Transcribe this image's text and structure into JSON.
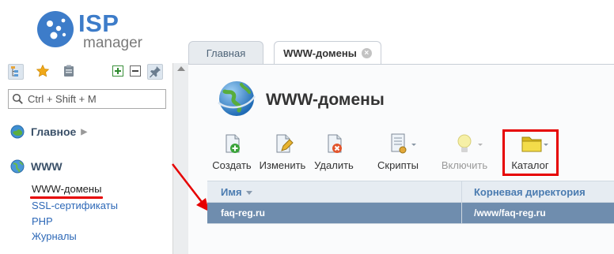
{
  "logo": {
    "brand": "ISP",
    "product": "manager"
  },
  "sidebar": {
    "search_placeholder": "Ctrl + Shift + M",
    "groups": [
      {
        "label": "Главное",
        "icon": "home-globe-icon",
        "collapsed": true
      },
      {
        "label": "WWW",
        "icon": "globe-icon",
        "collapsed": false
      }
    ],
    "items": [
      {
        "label": "WWW-домены",
        "active": true
      },
      {
        "label": "SSL-сертификаты"
      },
      {
        "label": "PHP"
      },
      {
        "label": "Журналы"
      }
    ]
  },
  "tabs": [
    {
      "label": "Главная",
      "active": false
    },
    {
      "label": "WWW-домены",
      "active": true,
      "closable": true
    }
  ],
  "page": {
    "title": "WWW-домены"
  },
  "toolbar": {
    "create": "Создать",
    "edit": "Изменить",
    "delete": "Удалить",
    "scripts": "Скрипты",
    "enable": "Включить",
    "catalog": "Каталог"
  },
  "table": {
    "columns": [
      "Имя",
      "Корневая директория"
    ],
    "rows": [
      [
        "faq-reg.ru",
        "/www/faq-reg.ru"
      ]
    ]
  },
  "colors": {
    "accent": "#3d7cc9",
    "selected_row": "#6f8dae",
    "annotation": "#e60000"
  }
}
